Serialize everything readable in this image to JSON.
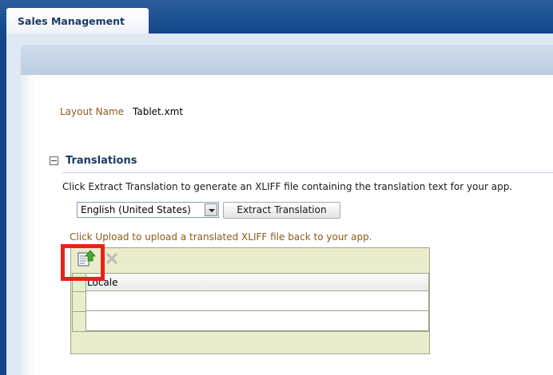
{
  "app": {
    "title": "Sales Management"
  },
  "layout": {
    "label": "Layout Name",
    "value": "Tablet.xmt"
  },
  "translations": {
    "title": "Translations",
    "instructions": "Click Extract Translation to generate an XLIFF file containing the translation text for your app.",
    "locale_selected": "English (United States)",
    "extract_button": "Extract Translation",
    "upload_instructions": "Click Upload to upload a translated XLIFF file back to your app."
  },
  "table": {
    "toolbar": {
      "upload_icon": "upload-icon",
      "delete_icon": "delete-icon"
    },
    "columns": [
      "Locale"
    ],
    "rows": [
      {
        "locale": ""
      },
      {
        "locale": ""
      }
    ]
  },
  "colors": {
    "header_blue": "#13478a",
    "panel_khaki": "#eaeccc",
    "label_brown": "#8a5a1e",
    "highlight_red": "#e8231b"
  }
}
